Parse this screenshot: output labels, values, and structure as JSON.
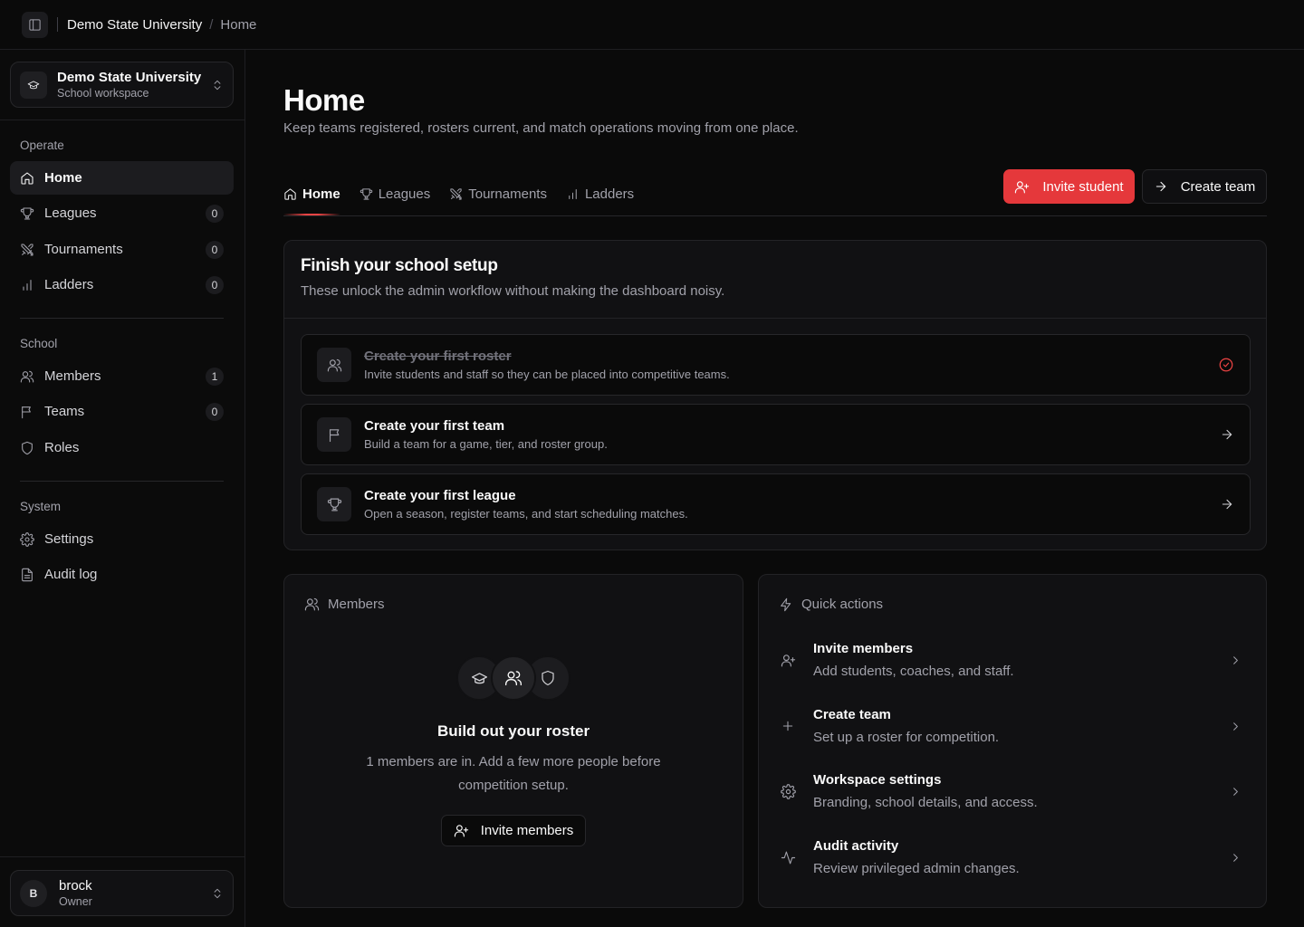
{
  "breadcrumb": {
    "root": "Demo State University",
    "separator": "/",
    "current": "Home"
  },
  "workspace": {
    "name": "Demo State University",
    "subtitle": "School workspace"
  },
  "sidebar": {
    "operate_label": "Operate",
    "operate_items": [
      {
        "label": "Home",
        "icon": "home-icon"
      },
      {
        "label": "Leagues",
        "icon": "trophy-icon",
        "count": "0"
      },
      {
        "label": "Tournaments",
        "icon": "swords-icon",
        "count": "0"
      },
      {
        "label": "Ladders",
        "icon": "bar-chart-icon",
        "count": "0"
      }
    ],
    "school_label": "School",
    "school_items": [
      {
        "label": "Members",
        "icon": "users-icon",
        "count": "1"
      },
      {
        "label": "Teams",
        "icon": "flag-icon",
        "count": "0"
      },
      {
        "label": "Roles",
        "icon": "shield-icon"
      }
    ],
    "system_label": "System",
    "system_items": [
      {
        "label": "Settings",
        "icon": "gear-icon"
      },
      {
        "label": "Audit log",
        "icon": "file-text-icon"
      }
    ]
  },
  "user": {
    "initial": "B",
    "name": "brock",
    "role": "Owner"
  },
  "page": {
    "title": "Home",
    "description": "Keep teams registered, rosters current, and match operations moving from one place."
  },
  "tabs": [
    {
      "label": "Home",
      "icon": "home-icon",
      "active": true
    },
    {
      "label": "Leagues",
      "icon": "trophy-icon"
    },
    {
      "label": "Tournaments",
      "icon": "swords-icon"
    },
    {
      "label": "Ladders",
      "icon": "bar-chart-icon"
    }
  ],
  "actions": {
    "invite_student": "Invite student",
    "create_team": "Create team"
  },
  "setup": {
    "title": "Finish your school setup",
    "subtitle": "These unlock the admin workflow without making the dashboard noisy.",
    "steps": [
      {
        "title": "Create your first roster",
        "desc": "Invite students and staff so they can be placed into competitive teams.",
        "done": true,
        "icon": "users-icon"
      },
      {
        "title": "Create your first team",
        "desc": "Build a team for a game, tier, and roster group.",
        "done": false,
        "icon": "flag-icon"
      },
      {
        "title": "Create your first league",
        "desc": "Open a season, register teams, and start scheduling matches.",
        "done": false,
        "icon": "trophy-icon"
      }
    ]
  },
  "members_card": {
    "heading": "Members",
    "title": "Build out your roster",
    "desc": "1 members are in. Add a few more people before competition setup.",
    "button": "Invite members"
  },
  "quick_actions": {
    "heading": "Quick actions",
    "items": [
      {
        "title": "Invite members",
        "desc": "Add students, coaches, and staff.",
        "icon": "user-plus-icon"
      },
      {
        "title": "Create team",
        "desc": "Set up a roster for competition.",
        "icon": "plus-icon"
      },
      {
        "title": "Workspace settings",
        "desc": "Branding, school details, and access.",
        "icon": "gear-icon"
      },
      {
        "title": "Audit activity",
        "desc": "Review privileged admin changes.",
        "icon": "activity-icon"
      }
    ]
  },
  "colors": {
    "accent": "#e5383b",
    "background": "#0a0a0a",
    "surface": "#111113",
    "border": "#27272a"
  }
}
